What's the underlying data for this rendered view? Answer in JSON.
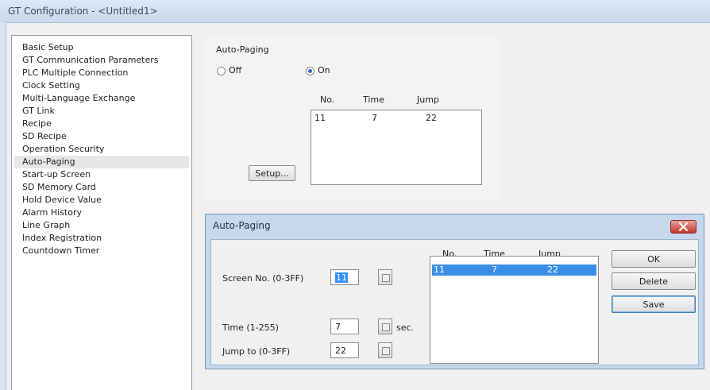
{
  "window": {
    "title": "GT Configuration - <Untitled1>"
  },
  "sidebar": {
    "items": [
      "Basic Setup",
      "GT Communication Parameters",
      "PLC Multiple Connection",
      "Clock Setting",
      "Multi-Language Exchange",
      "GT Link",
      "Recipe",
      "SD Recipe",
      "Operation Security",
      "Auto-Paging",
      "Start-up Screen",
      "SD Memory Card",
      "Hold Device Value",
      "Alarm History",
      "Line Graph",
      "Index Registration",
      "Countdown Timer"
    ],
    "selected": "Auto-Paging"
  },
  "auto_paging_panel": {
    "group_label": "Auto-Paging",
    "off_label": "Off",
    "on_label": "On",
    "selected_option": "On",
    "columns": [
      "No.",
      "Time",
      "Jump"
    ],
    "rows": [
      {
        "no": "11",
        "time": "7",
        "jump": "22"
      }
    ],
    "setup_button": "Setup..."
  },
  "dialog": {
    "title": "Auto-Paging",
    "screen_no_label": "Screen No. (0-3FF)",
    "screen_no_value": "11",
    "time_label": "Time (1-255)",
    "time_value": "7",
    "time_unit": "sec.",
    "jump_label": "Jump to (0-3FF)",
    "jump_value": "22",
    "columns": [
      "No.",
      "Time",
      "Jump"
    ],
    "rows": [
      {
        "no": "11",
        "time": "7",
        "jump": "22"
      }
    ],
    "ok_button": "OK",
    "delete_button": "Delete",
    "save_button": "Save"
  }
}
